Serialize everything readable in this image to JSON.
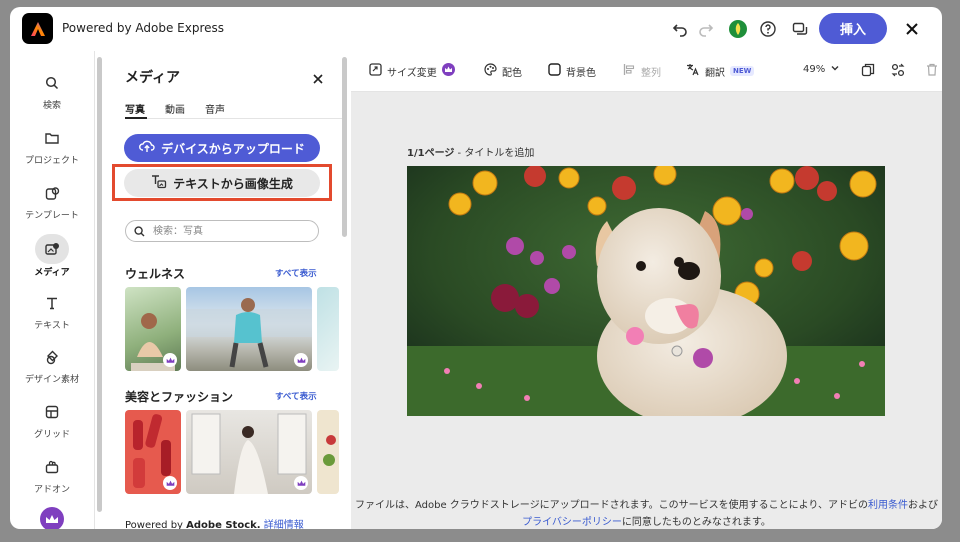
{
  "header": {
    "title": "Powered by Adobe Express",
    "insert_label": "挿入"
  },
  "rail": {
    "items": [
      {
        "label": "検索",
        "icon": "search-icon"
      },
      {
        "label": "プロジェクト",
        "icon": "folder-icon"
      },
      {
        "label": "テンプレート",
        "icon": "template-icon"
      },
      {
        "label": "メディア",
        "icon": "media-icon",
        "active": true
      },
      {
        "label": "テキスト",
        "icon": "text-icon"
      },
      {
        "label": "デザイン素材",
        "icon": "shapes-icon"
      },
      {
        "label": "グリッド",
        "icon": "grid-icon"
      },
      {
        "label": "アドオン",
        "icon": "addon-icon"
      }
    ]
  },
  "panel": {
    "title": "メディア",
    "tabs": [
      "写真",
      "動画",
      "音声"
    ],
    "upload_label": "デバイスからアップロード",
    "generate_label": "テキストから画像生成",
    "search_placeholder": "検索：写真",
    "section1_title": "ウェルネス",
    "section2_title": "美容とファッション",
    "see_all": "すべて表示",
    "footer_prefix": "Powered by",
    "footer_brand": "Adobe Stock.",
    "footer_link": "詳細情報"
  },
  "toolbar": {
    "resize": "サイズ変更",
    "color": "配色",
    "background": "背景色",
    "align": "整列",
    "translate": "翻訳",
    "new_badge": "NEW",
    "zoom": "49%"
  },
  "canvas": {
    "page_number": "1/1ページ",
    "page_title": " - タイトルを追加",
    "note_part1": "ファイルは、Adobe クラウドストレージにアップロードされます。このサービスを使用することにより、アドビの",
    "note_link1": "利用条件",
    "note_part2": "および",
    "note_link2": "プライバシーポリシー",
    "note_part3": "に同意したものとみなされます。"
  },
  "colors": {
    "accent": "#4f5bd5",
    "highlight": "#e34a2e",
    "link": "#3a5bd0"
  }
}
